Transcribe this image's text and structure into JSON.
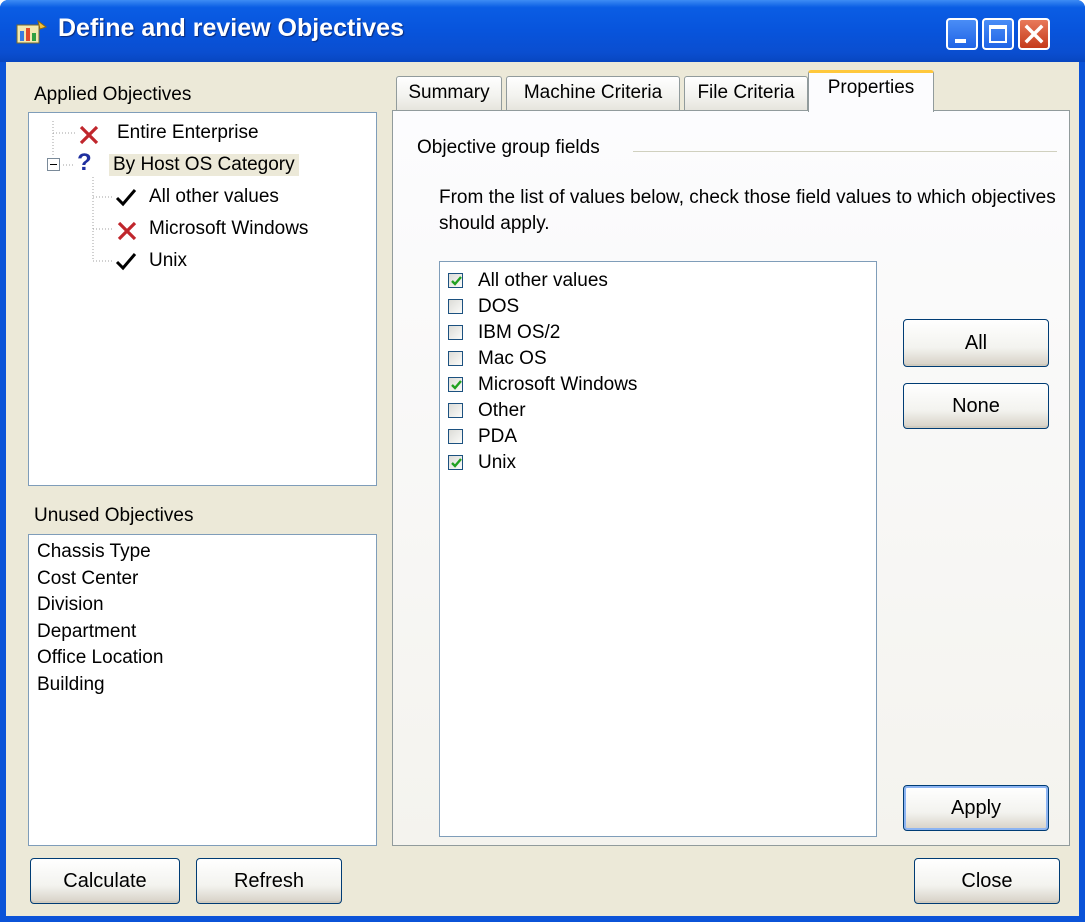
{
  "window": {
    "title": "Define and review Objectives"
  },
  "applied": {
    "label": "Applied Objectives",
    "tree": [
      {
        "label": "Entire Enterprise",
        "icon": "red-x-icon"
      },
      {
        "label": "By Host OS Category",
        "icon": "question-icon"
      },
      {
        "label": "All other values",
        "icon": "check-icon"
      },
      {
        "label": "Microsoft Windows",
        "icon": "red-x-icon"
      },
      {
        "label": "Unix",
        "icon": "check-icon"
      }
    ]
  },
  "unused": {
    "label": "Unused Objectives",
    "items": [
      "Chassis Type",
      "Cost Center",
      "Division",
      "Department",
      "Office Location",
      "Building"
    ]
  },
  "tabs": [
    "Summary",
    "Machine Criteria",
    "File Criteria",
    "Properties"
  ],
  "active_tab": "Properties",
  "properties": {
    "group_title": "Objective group fields",
    "description": "From the list of values below, check those field values to which objectives should apply.",
    "values": [
      {
        "label": "All other values",
        "checked": true
      },
      {
        "label": "DOS",
        "checked": false
      },
      {
        "label": "IBM OS/2",
        "checked": false
      },
      {
        "label": "Mac OS",
        "checked": false
      },
      {
        "label": "Microsoft Windows",
        "checked": true
      },
      {
        "label": "Other",
        "checked": false
      },
      {
        "label": "PDA",
        "checked": false
      },
      {
        "label": "Unix",
        "checked": true
      }
    ],
    "all_label": "All",
    "none_label": "None",
    "apply_label": "Apply"
  },
  "buttons": {
    "calculate": "Calculate",
    "refresh": "Refresh",
    "close": "Close"
  },
  "colors": {
    "titlebar": "#0854dc",
    "dialog_bg": "#ece9d8",
    "check_green": "#21a121",
    "x_red": "#c0262c",
    "question_blue": "#1f2f9f",
    "tab_highlight": "#ffc83c"
  }
}
